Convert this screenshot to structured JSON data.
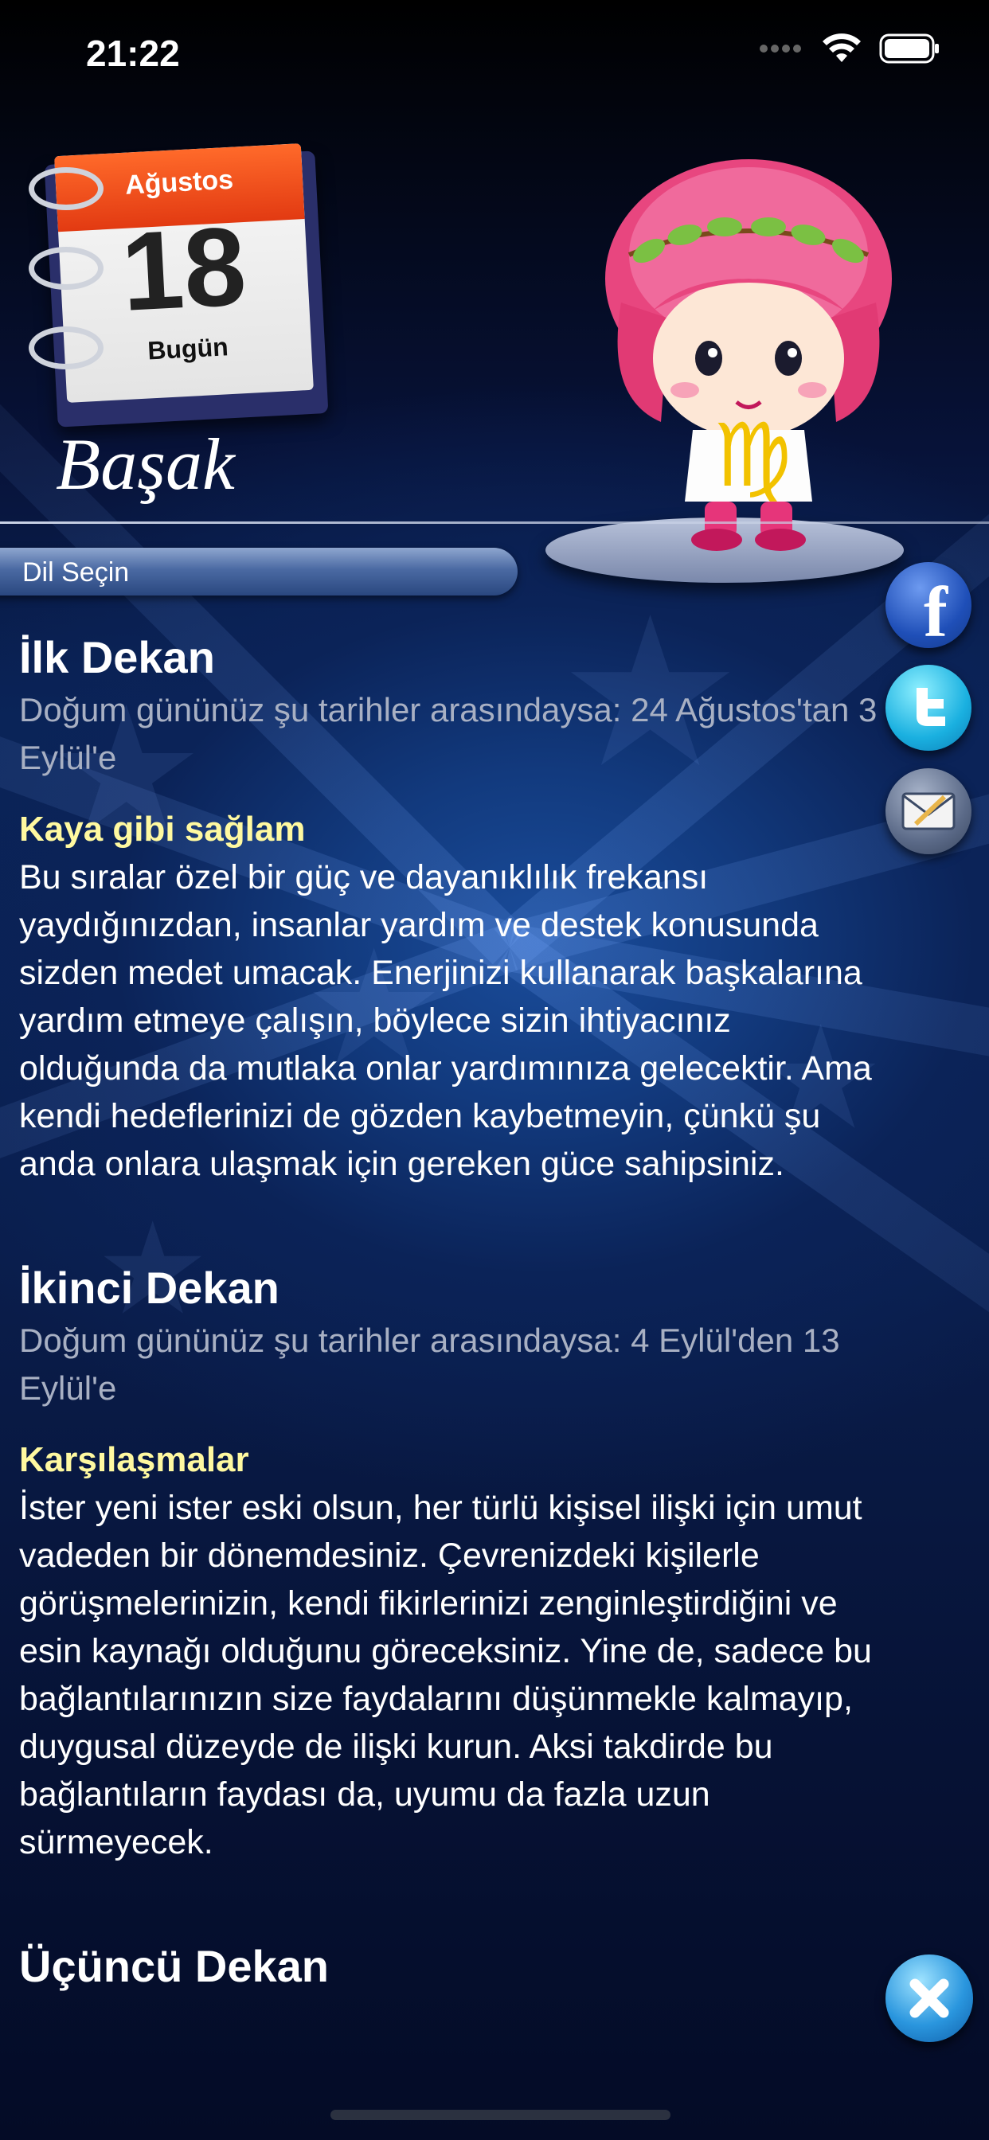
{
  "status_bar": {
    "time": "21:22"
  },
  "calendar": {
    "month": "Ağustos",
    "day": "18",
    "label": "Bugün"
  },
  "sign": {
    "name": "Başak",
    "symbol": "♍"
  },
  "language": {
    "label": "Dil Seçin"
  },
  "sections": [
    {
      "title": "İlk Dekan",
      "dates": "Doğum gününüz şu tarihler arasındaysa: 24 Ağustos'tan 3 Eylül'e",
      "subtitle": "Kaya gibi sağlam",
      "body": "Bu sıralar özel bir güç ve dayanıklılık frekansı yaydığınızdan, insanlar yardım ve destek konusunda sizden medet umacak. Enerjinizi kullanarak başkalarına yardım etmeye çalışın, böylece sizin ihtiyacınız olduğunda da mutlaka onlar yardımınıza gelecektir. Ama kendi hedeflerinizi de gözden kaybetmeyin, çünkü şu anda onlara ulaşmak için gereken güce sahipsiniz."
    },
    {
      "title": "İkinci Dekan",
      "dates": "Doğum gününüz şu tarihler arasındaysa: 4 Eylül'den 13 Eylül'e",
      "subtitle": "Karşılaşmalar",
      "body": "İster yeni ister eski olsun, her türlü kişisel ilişki için umut vadeden bir dönemdesiniz. Çevrenizdeki kişilerle görüşmelerinizin, kendi fikirlerinizi zenginleştirdiğini ve esin kaynağı olduğunu göreceksiniz. Yine de, sadece bu bağlantılarınızın size faydalarını düşünmekle kalmayıp, duygusal düzeyde de ilişki kurun. Aksi takdirde bu bağlantıların faydası da, uyumu da fazla uzun sürmeyecek."
    },
    {
      "title": "Üçüncü Dekan"
    }
  ],
  "share": {
    "facebook_glyph": "f"
  },
  "icons": [
    "signal-icon",
    "wifi-icon",
    "battery-icon",
    "facebook-icon",
    "twitter-icon",
    "mail-icon",
    "close-icon"
  ],
  "colors": {
    "subtitle": "#fff9a0",
    "dates": "#a8b0c3",
    "calendar_header": "#e23a12"
  }
}
